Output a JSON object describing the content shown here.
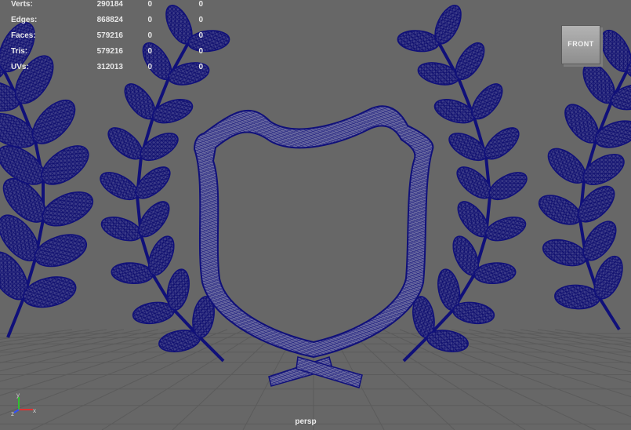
{
  "stats": [
    {
      "label": "Verts:",
      "values": [
        "290184",
        "0",
        "0"
      ]
    },
    {
      "label": "Edges:",
      "values": [
        "868824",
        "0",
        "0"
      ]
    },
    {
      "label": "Faces:",
      "values": [
        "579216",
        "0",
        "0"
      ]
    },
    {
      "label": "Tris:",
      "values": [
        "579216",
        "0",
        "0"
      ]
    },
    {
      "label": "UVs:",
      "values": [
        "312013",
        "0",
        "0"
      ]
    }
  ],
  "view_cube": {
    "label": "FRONT"
  },
  "camera": {
    "label": "persp"
  },
  "axis_labels": {
    "x": "x",
    "y": "y",
    "z": "z"
  },
  "colors": {
    "background": "#676767",
    "wireframe": "#1a1a7a",
    "wire_fill": "#3f3f8a",
    "grid": "#5a5a5a"
  }
}
